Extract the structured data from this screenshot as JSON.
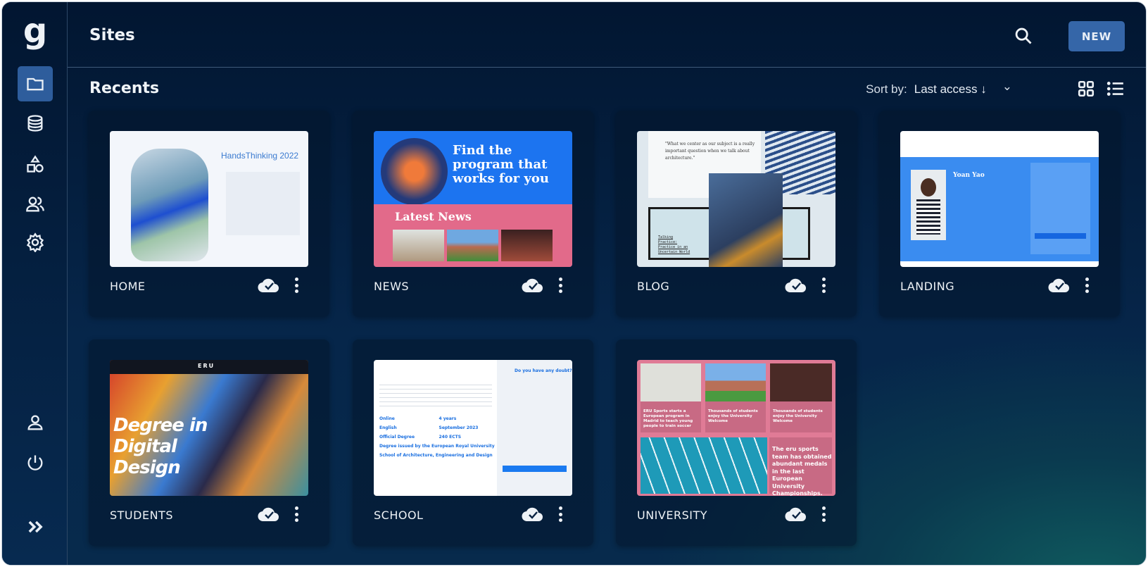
{
  "app": {
    "logo": "g",
    "title": "Sites"
  },
  "header": {
    "new_label": "NEW",
    "search_icon": "search-icon"
  },
  "section": {
    "title": "Recents",
    "sort_label": "Sort by:",
    "sort_value": "Last access ↓",
    "sort_chevron": "⌄"
  },
  "sidebar": {
    "items": [
      {
        "name": "sites",
        "icon": "folder-icon",
        "active": true
      },
      {
        "name": "data",
        "icon": "database-icon"
      },
      {
        "name": "components",
        "icon": "shapes-icon"
      },
      {
        "name": "users",
        "icon": "users-icon"
      },
      {
        "name": "settings",
        "icon": "gear-icon"
      },
      {
        "name": "profile",
        "icon": "user-icon"
      },
      {
        "name": "logout",
        "icon": "power-icon"
      },
      {
        "name": "expand",
        "icon": "chevrons-right-icon"
      }
    ]
  },
  "colors": {
    "accent": "#3566a8",
    "background": "#041a33",
    "news_blue": "#1c74f0",
    "news_pink": "#e26a8a"
  },
  "sites": [
    {
      "name": "HOME",
      "status": "synced",
      "thumb": {
        "title": "HandsThinking 2022"
      }
    },
    {
      "name": "NEWS",
      "status": "synced",
      "thumb": {
        "headline": "Find the program that works for you",
        "section": "Latest News"
      }
    },
    {
      "name": "BLOG",
      "status": "synced",
      "thumb": {
        "quote": "\"What we center as our subject is a really important question when we talk about architecture.\"",
        "caption": "Talking Practice: Practice in an Uncertain World"
      }
    },
    {
      "name": "LANDING",
      "status": "synced",
      "thumb": {
        "person": "Yoan Yao"
      }
    },
    {
      "name": "STUDENTS",
      "status": "synced",
      "thumb": {
        "headline": "Degree in Digital Design",
        "brand": "ERU"
      }
    },
    {
      "name": "SCHOOL",
      "status": "synced",
      "thumb": {
        "heading": "Do you have any doubt?",
        "facts": [
          "Online",
          "4 years",
          "English",
          "September 2023",
          "Official Degree",
          "240 ECTS",
          "Degree issued by the European Royal University",
          "School of Architecture, Engineering and Design"
        ]
      }
    },
    {
      "name": "UNIVERSITY",
      "status": "synced",
      "thumb": {
        "news": [
          "ERU Sports starts a European program in Madrid to teach young people to train soccer",
          "Thousands of students enjoy the University Welcome",
          "Thousands of students enjoy the University Welcome"
        ],
        "feature": "The eru sports team has obtained abundant medals in the last European University Championships."
      }
    }
  ]
}
